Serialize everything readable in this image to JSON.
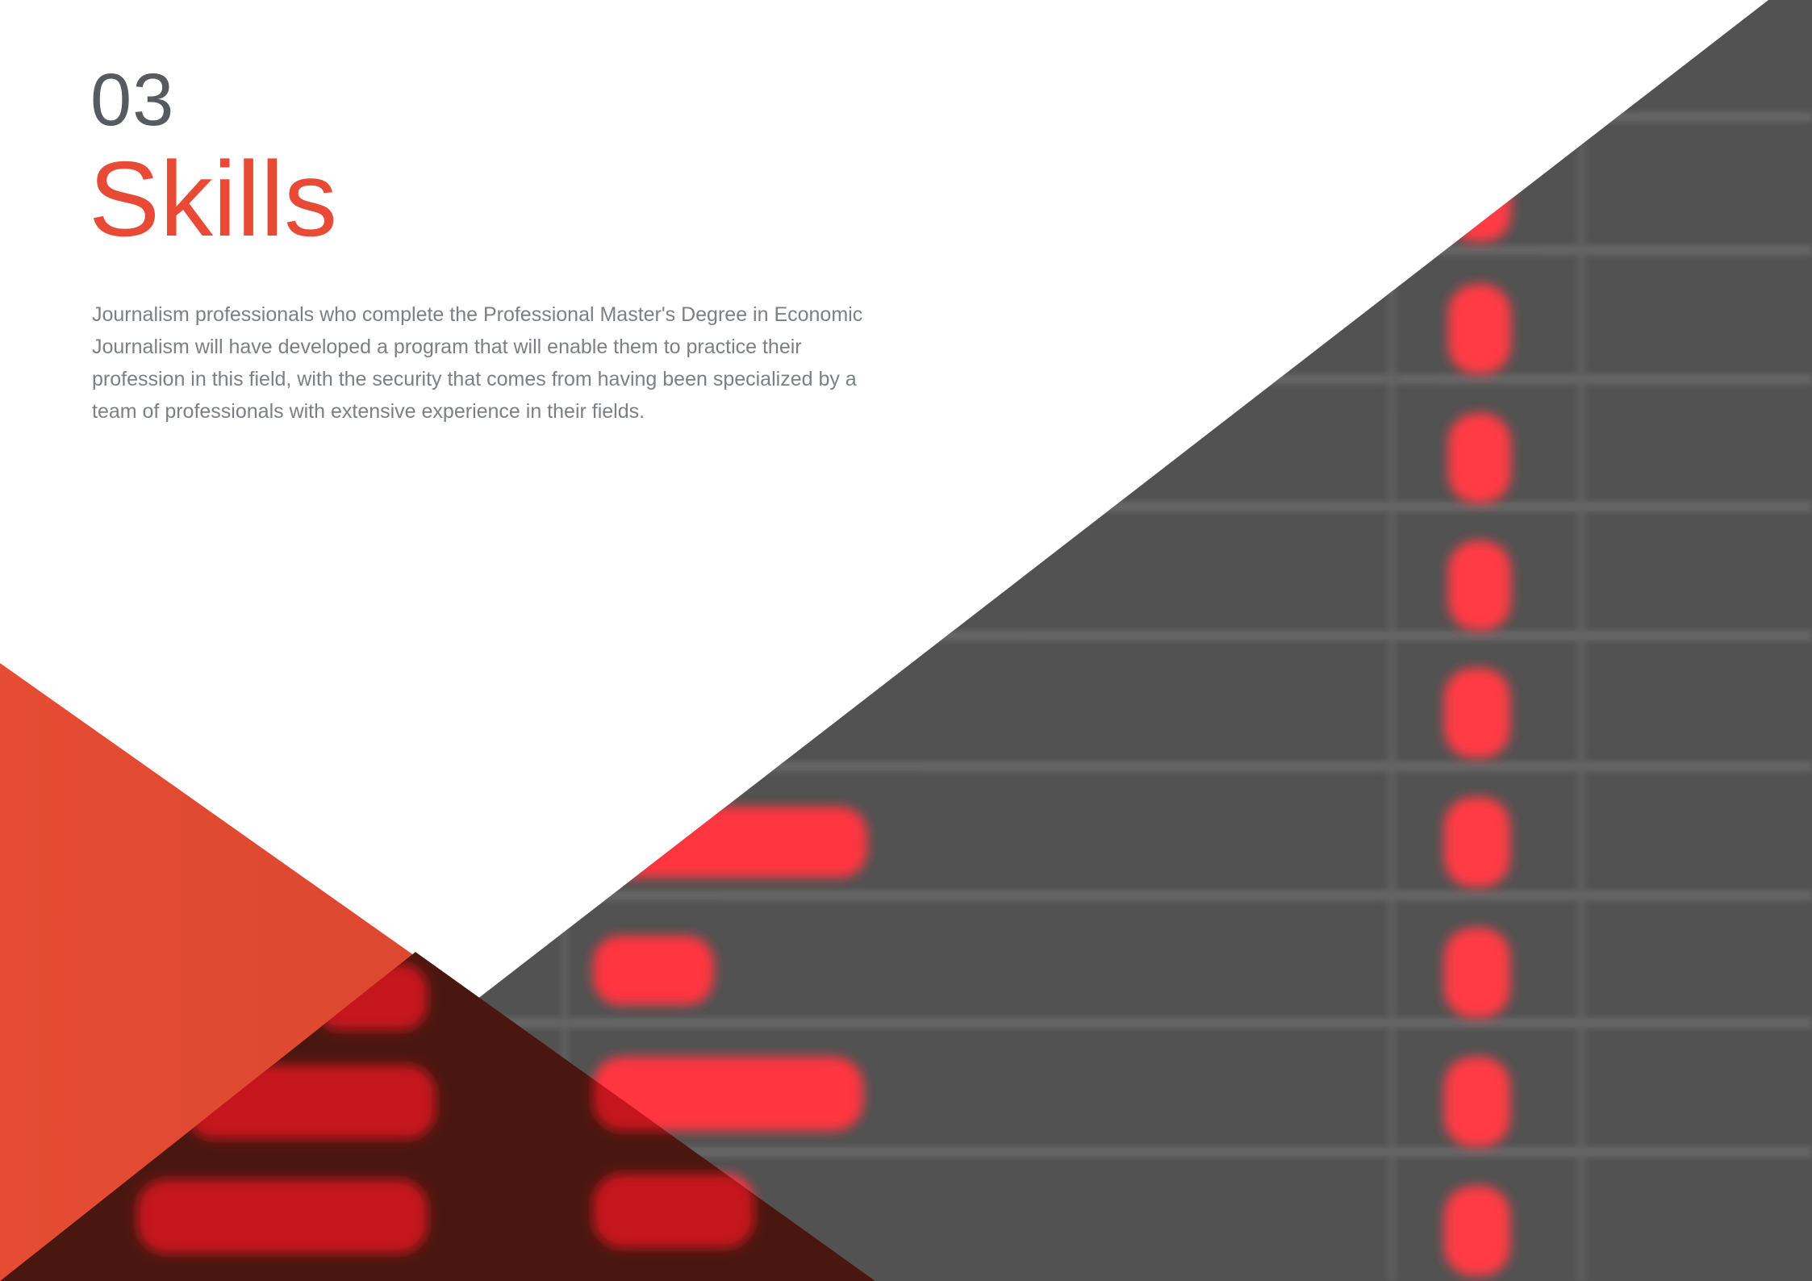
{
  "section": {
    "number": "03",
    "title": "Skills",
    "body": "Journalism professionals who complete the Professional Master's Degree in Economic Journalism will have developed a program that will enable them to practice their profession in this field, with the security that comes from having been specialized by a team of professionals with extensive experience in their fields."
  },
  "colors": {
    "accent": "#e84a35",
    "number": "#575b5f",
    "body_text": "#7c7f83",
    "board_background": "#525252",
    "board_led": "#ff3b44",
    "board_led_dim": "#c4161c"
  },
  "artwork": {
    "description_icon": "blurred-departure-board-image"
  }
}
